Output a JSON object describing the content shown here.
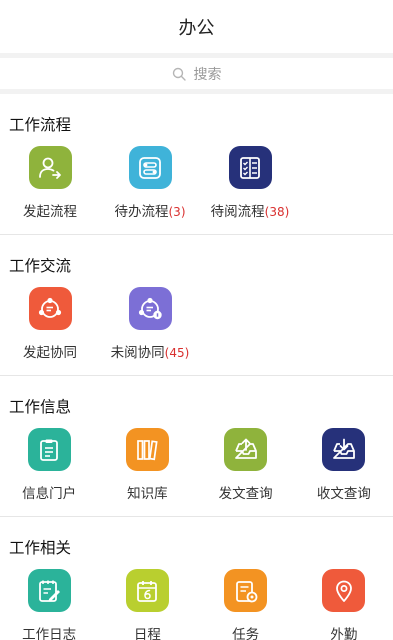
{
  "header": {
    "title": "办公"
  },
  "search": {
    "placeholder": "搜索"
  },
  "sections": [
    {
      "title": "工作流程",
      "items": [
        {
          "label": "发起流程",
          "count": "",
          "color": "#8fb33c",
          "icon": "person-arrow-icon"
        },
        {
          "label": "待办流程",
          "count": "(3)",
          "color": "#3fb3d9",
          "icon": "flow-switch-icon"
        },
        {
          "label": "待阅流程",
          "count": "(38)",
          "color": "#26317a",
          "icon": "checklist-icon"
        }
      ]
    },
    {
      "title": "工作交流",
      "items": [
        {
          "label": "发起协同",
          "count": "",
          "color": "#ef5a3b",
          "icon": "collab-send-icon"
        },
        {
          "label": "未阅协同",
          "count": "(45)",
          "color": "#7c6fd6",
          "icon": "collab-unread-icon"
        }
      ]
    },
    {
      "title": "工作信息",
      "items": [
        {
          "label": "信息门户",
          "count": "",
          "color": "#2bb39a",
          "icon": "clipboard-icon"
        },
        {
          "label": "知识库",
          "count": "",
          "color": "#f39322",
          "icon": "books-icon"
        },
        {
          "label": "发文查询",
          "count": "",
          "color": "#8fb33c",
          "icon": "tray-out-icon"
        },
        {
          "label": "收文查询",
          "count": "",
          "color": "#26317a",
          "icon": "tray-in-icon"
        }
      ]
    },
    {
      "title": "工作相关",
      "items": [
        {
          "label": "工作日志",
          "count": "",
          "color": "#2bb39a",
          "icon": "log-pencil-icon"
        },
        {
          "label": "日程",
          "count": "",
          "color": "#b9cf2f",
          "icon": "calendar-icon"
        },
        {
          "label": "任务",
          "count": "",
          "color": "#f39322",
          "icon": "task-gear-icon"
        },
        {
          "label": "外勤",
          "count": "",
          "color": "#ef5a3b",
          "icon": "location-pin-icon"
        }
      ]
    }
  ]
}
